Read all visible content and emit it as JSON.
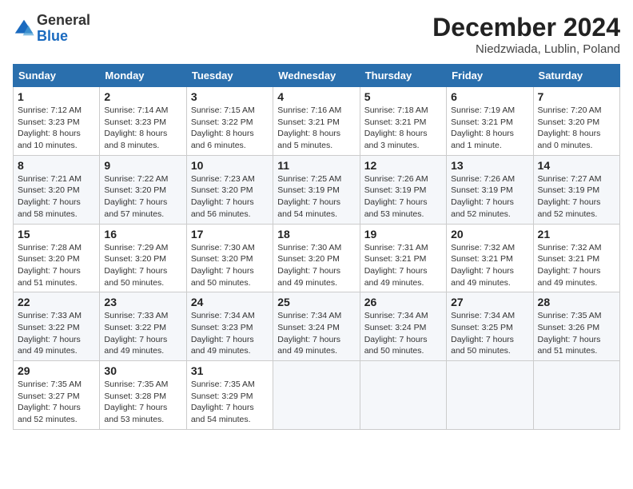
{
  "header": {
    "logo_line1": "General",
    "logo_line2": "Blue",
    "month_title": "December 2024",
    "location": "Niedzwiada, Lublin, Poland"
  },
  "weekdays": [
    "Sunday",
    "Monday",
    "Tuesday",
    "Wednesday",
    "Thursday",
    "Friday",
    "Saturday"
  ],
  "weeks": [
    [
      {
        "day": "1",
        "info": "Sunrise: 7:12 AM\nSunset: 3:23 PM\nDaylight: 8 hours\nand 10 minutes."
      },
      {
        "day": "2",
        "info": "Sunrise: 7:14 AM\nSunset: 3:23 PM\nDaylight: 8 hours\nand 8 minutes."
      },
      {
        "day": "3",
        "info": "Sunrise: 7:15 AM\nSunset: 3:22 PM\nDaylight: 8 hours\nand 6 minutes."
      },
      {
        "day": "4",
        "info": "Sunrise: 7:16 AM\nSunset: 3:21 PM\nDaylight: 8 hours\nand 5 minutes."
      },
      {
        "day": "5",
        "info": "Sunrise: 7:18 AM\nSunset: 3:21 PM\nDaylight: 8 hours\nand 3 minutes."
      },
      {
        "day": "6",
        "info": "Sunrise: 7:19 AM\nSunset: 3:21 PM\nDaylight: 8 hours\nand 1 minute."
      },
      {
        "day": "7",
        "info": "Sunrise: 7:20 AM\nSunset: 3:20 PM\nDaylight: 8 hours\nand 0 minutes."
      }
    ],
    [
      {
        "day": "8",
        "info": "Sunrise: 7:21 AM\nSunset: 3:20 PM\nDaylight: 7 hours\nand 58 minutes."
      },
      {
        "day": "9",
        "info": "Sunrise: 7:22 AM\nSunset: 3:20 PM\nDaylight: 7 hours\nand 57 minutes."
      },
      {
        "day": "10",
        "info": "Sunrise: 7:23 AM\nSunset: 3:20 PM\nDaylight: 7 hours\nand 56 minutes."
      },
      {
        "day": "11",
        "info": "Sunrise: 7:25 AM\nSunset: 3:19 PM\nDaylight: 7 hours\nand 54 minutes."
      },
      {
        "day": "12",
        "info": "Sunrise: 7:26 AM\nSunset: 3:19 PM\nDaylight: 7 hours\nand 53 minutes."
      },
      {
        "day": "13",
        "info": "Sunrise: 7:26 AM\nSunset: 3:19 PM\nDaylight: 7 hours\nand 52 minutes."
      },
      {
        "day": "14",
        "info": "Sunrise: 7:27 AM\nSunset: 3:19 PM\nDaylight: 7 hours\nand 52 minutes."
      }
    ],
    [
      {
        "day": "15",
        "info": "Sunrise: 7:28 AM\nSunset: 3:20 PM\nDaylight: 7 hours\nand 51 minutes."
      },
      {
        "day": "16",
        "info": "Sunrise: 7:29 AM\nSunset: 3:20 PM\nDaylight: 7 hours\nand 50 minutes."
      },
      {
        "day": "17",
        "info": "Sunrise: 7:30 AM\nSunset: 3:20 PM\nDaylight: 7 hours\nand 50 minutes."
      },
      {
        "day": "18",
        "info": "Sunrise: 7:30 AM\nSunset: 3:20 PM\nDaylight: 7 hours\nand 49 minutes."
      },
      {
        "day": "19",
        "info": "Sunrise: 7:31 AM\nSunset: 3:21 PM\nDaylight: 7 hours\nand 49 minutes."
      },
      {
        "day": "20",
        "info": "Sunrise: 7:32 AM\nSunset: 3:21 PM\nDaylight: 7 hours\nand 49 minutes."
      },
      {
        "day": "21",
        "info": "Sunrise: 7:32 AM\nSunset: 3:21 PM\nDaylight: 7 hours\nand 49 minutes."
      }
    ],
    [
      {
        "day": "22",
        "info": "Sunrise: 7:33 AM\nSunset: 3:22 PM\nDaylight: 7 hours\nand 49 minutes."
      },
      {
        "day": "23",
        "info": "Sunrise: 7:33 AM\nSunset: 3:22 PM\nDaylight: 7 hours\nand 49 minutes."
      },
      {
        "day": "24",
        "info": "Sunrise: 7:34 AM\nSunset: 3:23 PM\nDaylight: 7 hours\nand 49 minutes."
      },
      {
        "day": "25",
        "info": "Sunrise: 7:34 AM\nSunset: 3:24 PM\nDaylight: 7 hours\nand 49 minutes."
      },
      {
        "day": "26",
        "info": "Sunrise: 7:34 AM\nSunset: 3:24 PM\nDaylight: 7 hours\nand 50 minutes."
      },
      {
        "day": "27",
        "info": "Sunrise: 7:34 AM\nSunset: 3:25 PM\nDaylight: 7 hours\nand 50 minutes."
      },
      {
        "day": "28",
        "info": "Sunrise: 7:35 AM\nSunset: 3:26 PM\nDaylight: 7 hours\nand 51 minutes."
      }
    ],
    [
      {
        "day": "29",
        "info": "Sunrise: 7:35 AM\nSunset: 3:27 PM\nDaylight: 7 hours\nand 52 minutes."
      },
      {
        "day": "30",
        "info": "Sunrise: 7:35 AM\nSunset: 3:28 PM\nDaylight: 7 hours\nand 53 minutes."
      },
      {
        "day": "31",
        "info": "Sunrise: 7:35 AM\nSunset: 3:29 PM\nDaylight: 7 hours\nand 54 minutes."
      },
      null,
      null,
      null,
      null
    ]
  ]
}
